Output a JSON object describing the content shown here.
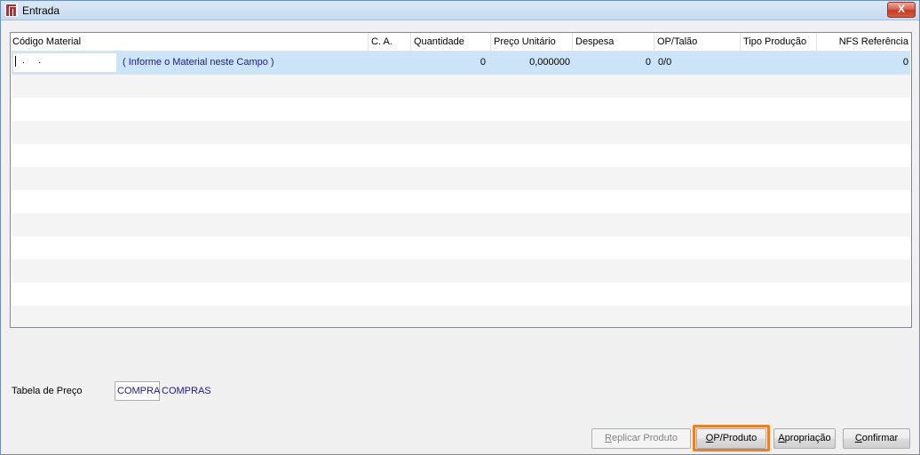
{
  "window": {
    "title": "Entrada",
    "close_label": "X"
  },
  "grid": {
    "columns": [
      "Código Material",
      "C. A.",
      "Quantidade",
      "Preço Unitário",
      "Despesa",
      "OP/Talão",
      "Tipo Produção",
      "NFS Referência"
    ],
    "rows": [
      {
        "codigo": ". .",
        "descricao": "( Informe o Material neste Campo )",
        "quantidade": "0",
        "preco_unitario": "0,000000",
        "despesa": "0",
        "op_talao": "0/0",
        "tipo_producao": "",
        "nfs_referencia": "0"
      }
    ]
  },
  "tabela_preco": {
    "label": "Tabela de Preço",
    "value": "COMPRA",
    "description": "COMPRAS"
  },
  "buttons": {
    "replicar": {
      "mnemonic": "R",
      "rest": "eplicar Produto"
    },
    "op_produto": {
      "mnemonic": "O",
      "rest": "P/Produto"
    },
    "apropriacao": {
      "mnemonic": "A",
      "rest": "propriação"
    },
    "confirmar": {
      "mnemonic": "C",
      "rest": "onfirmar"
    }
  }
}
